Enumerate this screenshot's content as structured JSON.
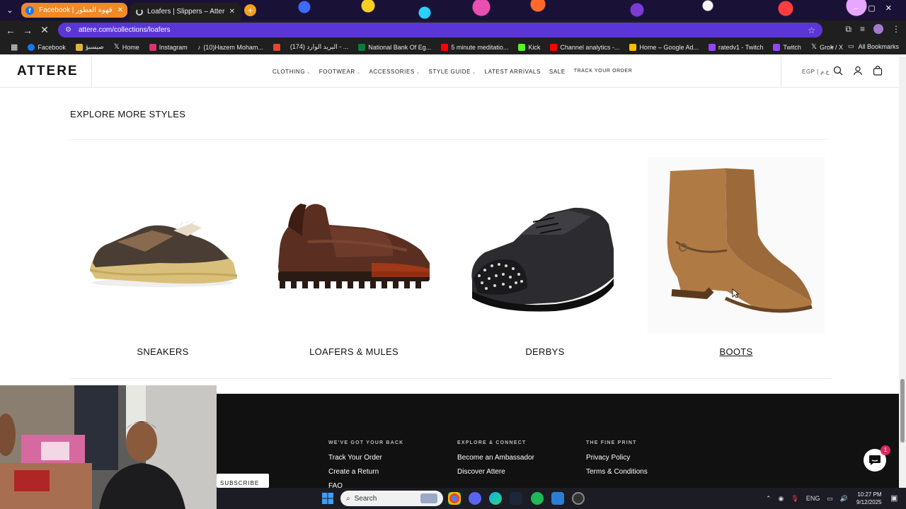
{
  "browser": {
    "tab_group_label": "Facebook | قهوة العطور",
    "active_tab_title": "Loafers | Slippers – Attere",
    "url": "attere.com/collections/loafers",
    "bookmarks": [
      {
        "label": "Facebook",
        "color": "#1877f2"
      },
      {
        "label": "صيسبؤ",
        "color": "#e2b33c"
      },
      {
        "label": "Home",
        "color": "#ffffff"
      },
      {
        "label": "Instagram",
        "color": "#e1306c"
      },
      {
        "label": "(10)Hazem Moham...",
        "color": "#ffffff"
      },
      {
        "label": "",
        "color": "#ea4335"
      },
      {
        "label": "(174) البريد الوارد - ...",
        "color": "#ffffff"
      },
      {
        "label": "National Bank Of Eg...",
        "color": "#0a7d3c"
      },
      {
        "label": "5 minute meditatio...",
        "color": "#ff0000"
      },
      {
        "label": "Kick",
        "color": "#53fc18"
      },
      {
        "label": "Channel analytics -...",
        "color": "#ff0000"
      },
      {
        "label": "Home – Google Ad...",
        "color": "#fbbc04"
      },
      {
        "label": "ratedv1 - Twitch",
        "color": "#9146ff"
      },
      {
        "label": "Twitch",
        "color": "#9146ff"
      },
      {
        "label": "Grok / X",
        "color": "#ffffff"
      }
    ],
    "all_bookmarks": "All Bookmarks"
  },
  "header": {
    "logo": "ATTERE",
    "nav": [
      {
        "label": "CLOTHING",
        "dropdown": true
      },
      {
        "label": "FOOTWEAR",
        "dropdown": true
      },
      {
        "label": "ACCESSORIES",
        "dropdown": true
      },
      {
        "label": "STYLE GUIDE",
        "dropdown": true
      },
      {
        "label": "LATEST ARRIVALS",
        "dropdown": false
      },
      {
        "label": "SALE",
        "dropdown": false
      },
      {
        "label": "TRACK YOUR ORDER",
        "dropdown": false
      }
    ],
    "currency": "EGP | ج.م"
  },
  "explore": {
    "title": "EXPLORE MORE STYLES",
    "categories": [
      {
        "label": "SNEAKERS"
      },
      {
        "label": "LOAFERS & MULES"
      },
      {
        "label": "DERBYS"
      },
      {
        "label": "BOOTS"
      }
    ]
  },
  "footer": {
    "subscribe_label": "SUBSCRIBE",
    "columns": [
      {
        "heading": "WE'VE GOT YOUR BACK",
        "links": [
          "Track Your Order",
          "Create a Return",
          "FAQ"
        ]
      },
      {
        "heading": "EXPLORE & CONNECT",
        "links": [
          "Become an Ambassador",
          "Discover Attere"
        ]
      },
      {
        "heading": "THE FINE PRINT",
        "links": [
          "Privacy Policy",
          "Terms & Conditions"
        ]
      }
    ],
    "chat_badge": "1"
  },
  "taskbar": {
    "search_placeholder": "Search",
    "language": "ENG",
    "time": "10:27 PM",
    "date": "9/12/2025"
  },
  "colors": {
    "accent_tab_group": "#f08a24",
    "omnibox": "#5a36d8",
    "footer_bg": "#111111"
  }
}
